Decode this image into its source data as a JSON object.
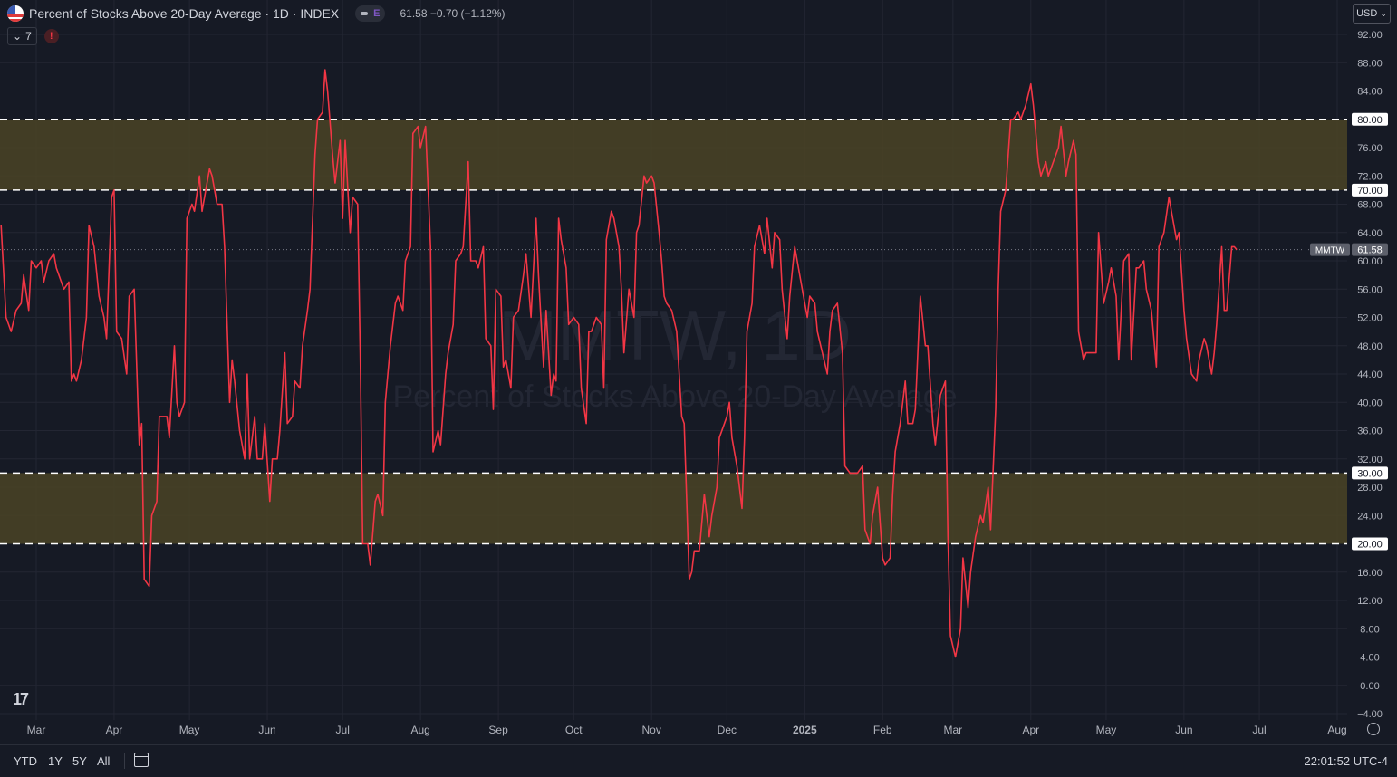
{
  "header": {
    "title": "Percent of Stocks Above 20-Day Average · 1D · INDEX",
    "pill_letter": "E",
    "ohlc": "61.58  −0.70 (−1.12%)",
    "indicator_count": "7",
    "warning": "!"
  },
  "currency": "USD",
  "watermark": {
    "symbol": "MMTW, 1D",
    "name": "Percent of Stocks Above 20-Day Average"
  },
  "ranges": [
    "YTD",
    "1Y",
    "5Y",
    "All"
  ],
  "clock": "22:01:52 UTC-4",
  "colors": {
    "line": "#f23645",
    "zone": "#4a4426",
    "bg": "#161a25",
    "grid": "#232633"
  },
  "chart_data": {
    "type": "line",
    "symbol_label": "MMTW",
    "last_value": 61.58,
    "ylim": [
      -4,
      94
    ],
    "y_ticks": [
      "92.00",
      "88.00",
      "84.00",
      "80.00",
      "76.00",
      "72.00",
      "70.00",
      "68.00",
      "64.00",
      "60.00",
      "56.00",
      "52.00",
      "48.00",
      "44.00",
      "40.00",
      "36.00",
      "32.00",
      "30.00",
      "28.00",
      "24.00",
      "20.00",
      "16.00",
      "12.00",
      "8.00",
      "4.00",
      "0.00",
      "−4.00"
    ],
    "x_ticks": [
      {
        "label": "Mar",
        "t": 29
      },
      {
        "label": "Apr",
        "t": 60
      },
      {
        "label": "May",
        "t": 90
      },
      {
        "label": "Jun",
        "t": 121
      },
      {
        "label": "Jul",
        "t": 151
      },
      {
        "label": "Aug",
        "t": 182
      },
      {
        "label": "Sep",
        "t": 213
      },
      {
        "label": "Oct",
        "t": 243
      },
      {
        "label": "Nov",
        "t": 274
      },
      {
        "label": "Dec",
        "t": 304
      },
      {
        "label": "2025",
        "t": 335
      },
      {
        "label": "Feb",
        "t": 366
      },
      {
        "label": "Mar",
        "t": 394
      },
      {
        "label": "Apr",
        "t": 425
      },
      {
        "label": "May",
        "t": 455
      },
      {
        "label": "Jun",
        "t": 486
      },
      {
        "label": "Jul",
        "t": 516
      },
      {
        "label": "Aug",
        "t": 547
      }
    ],
    "x_range": [
      15,
      552
    ],
    "horizontal_lines": [
      {
        "value": 80,
        "label": "80.00"
      },
      {
        "value": 70,
        "label": "70.00"
      },
      {
        "value": 30,
        "label": "30.00"
      },
      {
        "value": 20,
        "label": "20.00"
      }
    ],
    "zones": [
      [
        70,
        80
      ],
      [
        20,
        30
      ]
    ],
    "series": [
      {
        "t": [
          15,
          17,
          19,
          21,
          23,
          24,
          26,
          27,
          29,
          31,
          32,
          34,
          36,
          37,
          39,
          40,
          42,
          43,
          44,
          45,
          47,
          49,
          50,
          52,
          54,
          56,
          57,
          59,
          60,
          61,
          63,
          65,
          66,
          68,
          70,
          71,
          72,
          74,
          75,
          77,
          78,
          79,
          81,
          82,
          84,
          85,
          86,
          88,
          89,
          91,
          92,
          94,
          95,
          97,
          98,
          99,
          101,
          103,
          104,
          106,
          107,
          108,
          110,
          112,
          113,
          114,
          116,
          117,
          119,
          120,
          122,
          123,
          125,
          126,
          128,
          129,
          131,
          132,
          134,
          135,
          137,
          138,
          140,
          141,
          143,
          144,
          145,
          147,
          148,
          150,
          151,
          152,
          154,
          155,
          157,
          158,
          159,
          161,
          162,
          164,
          165,
          167,
          168,
          170,
          172,
          173,
          175,
          176,
          178,
          179,
          181,
          182,
          184,
          186,
          187,
          189,
          190,
          192,
          193,
          195,
          196,
          198,
          199,
          201,
          202,
          204,
          205,
          207,
          208,
          210,
          211,
          212,
          214,
          215,
          216,
          218,
          219,
          221,
          223,
          224,
          226,
          228,
          229,
          231,
          232,
          234,
          235,
          236,
          237,
          238,
          240,
          241,
          243,
          245,
          246,
          248,
          249,
          250,
          252,
          254,
          255,
          256,
          258,
          259,
          261,
          262,
          263,
          265,
          267,
          268,
          269,
          271,
          272,
          274,
          275,
          277,
          278,
          279,
          280,
          282,
          284,
          286,
          287,
          289,
          290,
          291,
          293,
          295,
          297,
          298,
          300,
          301,
          303,
          304,
          305,
          306,
          308,
          310,
          311,
          312,
          314,
          315,
          317,
          319,
          320,
          322,
          323,
          325,
          326,
          328,
          329,
          331,
          333,
          334,
          336,
          337,
          339,
          340,
          342,
          344,
          345,
          346,
          348,
          350,
          351,
          353,
          354,
          356,
          358,
          359,
          361,
          362,
          364,
          366,
          367,
          369,
          370,
          371,
          373,
          375,
          376,
          378,
          379,
          381,
          383,
          384,
          386,
          387,
          389,
          391,
          392,
          393,
          395,
          397,
          398,
          400,
          401,
          403,
          405,
          406,
          408,
          409,
          411,
          412,
          413,
          415,
          417,
          418,
          420,
          421,
          423,
          425,
          426,
          428,
          429,
          431,
          432,
          434,
          436,
          437,
          439,
          440,
          442,
          443,
          444,
          446,
          447,
          449,
          451,
          452,
          454,
          456,
          457,
          459,
          460,
          462,
          464,
          465,
          467,
          468,
          470,
          471,
          473,
          475,
          476,
          478,
          480,
          481,
          483,
          484,
          486,
          487,
          489,
          491,
          492,
          494,
          495,
          497,
          498,
          499,
          501,
          502,
          503,
          505,
          506,
          507,
          509,
          510,
          511,
          512,
          513,
          514
        ],
        "values": [
          65,
          52,
          50,
          53,
          54,
          58,
          53,
          60,
          59,
          60,
          57,
          60,
          61,
          59,
          57,
          56,
          57,
          43,
          44,
          43,
          46,
          52,
          65,
          62,
          55,
          52,
          49,
          69,
          70,
          50,
          49,
          44,
          55,
          56,
          34,
          37,
          15,
          14,
          24,
          26,
          38,
          38,
          38,
          35,
          48,
          40,
          38,
          40,
          66,
          68,
          67,
          72,
          67,
          71,
          73,
          72,
          68,
          68,
          62,
          40,
          46,
          43,
          36,
          32,
          44,
          32,
          38,
          32,
          32,
          37,
          26,
          32,
          32,
          36,
          47,
          37,
          38,
          43,
          42,
          48,
          53,
          56,
          75,
          80,
          81,
          87,
          84,
          75,
          71,
          77,
          66,
          77,
          64,
          69,
          68,
          47,
          20,
          20,
          17,
          26,
          27,
          24,
          40,
          48,
          54,
          55,
          53,
          60,
          62,
          78,
          79,
          76,
          79,
          62,
          33,
          36,
          34,
          44,
          47,
          51,
          60,
          61,
          62,
          74,
          60,
          60,
          59,
          62,
          49,
          48,
          39,
          56,
          55,
          45,
          46,
          42,
          52,
          53,
          58,
          61,
          52,
          66,
          58,
          45,
          53,
          41,
          44,
          43,
          66,
          63,
          59,
          51,
          52,
          51,
          42,
          37,
          50,
          50,
          52,
          51,
          42,
          63,
          67,
          66,
          62,
          56,
          47,
          56,
          52,
          64,
          65,
          72,
          71,
          72,
          71,
          64,
          60,
          55,
          54,
          53,
          50,
          38,
          37,
          15,
          16,
          19,
          19,
          27,
          21,
          24,
          28,
          35,
          37,
          38,
          40,
          35,
          31,
          25,
          35,
          50,
          54,
          62,
          65,
          61,
          66,
          59,
          64,
          63,
          56,
          49,
          55,
          62,
          58,
          56,
          52,
          55,
          54,
          50,
          47,
          44,
          50,
          53,
          54,
          47,
          31,
          30,
          30,
          30,
          31,
          22,
          20,
          24,
          28,
          18,
          17,
          18,
          27,
          33,
          37,
          43,
          37,
          37,
          39,
          55,
          48,
          48,
          37,
          34,
          41,
          43,
          21,
          7,
          4,
          8,
          18,
          11,
          16,
          21,
          24,
          23,
          28,
          22,
          39,
          56,
          67,
          70,
          80,
          80,
          81,
          80,
          82,
          85,
          82,
          74,
          72,
          74,
          72,
          74,
          76,
          79,
          72,
          74,
          77,
          75,
          50,
          46,
          47,
          47,
          47,
          64,
          54,
          57,
          59,
          55,
          46,
          60,
          61,
          46,
          59,
          59,
          60,
          56,
          53,
          45,
          62,
          64,
          69,
          67,
          63,
          64,
          53,
          49,
          44,
          43,
          46,
          49,
          48,
          44,
          47,
          51,
          62,
          53,
          53,
          62,
          62,
          61.58
        ]
      }
    ]
  }
}
